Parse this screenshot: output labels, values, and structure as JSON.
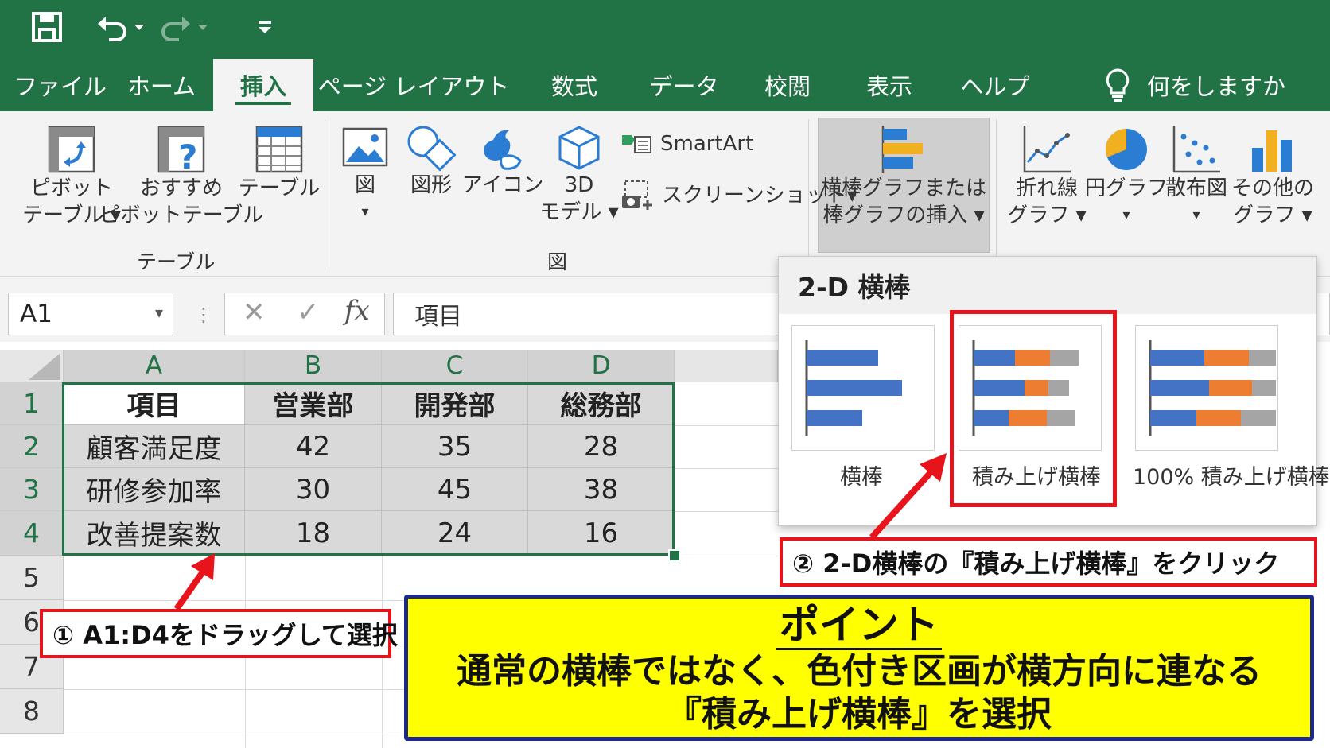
{
  "colors": {
    "excel_green": "#217346",
    "ribbon_bg": "#f3f3f3",
    "bar_blue": "#4472c4",
    "bar_orange": "#ed7d31",
    "bar_gray": "#a5a5a5",
    "annotation_red": "#e8141b",
    "point_yellow": "#ffff00",
    "point_border": "#1e2a8a"
  },
  "qat": {
    "save_icon": "save-icon",
    "undo_icon": "undo-icon",
    "redo_icon": "redo-icon",
    "customize_icon": "qat-dropdown-icon"
  },
  "tabs": [
    {
      "label": "ファイル"
    },
    {
      "label": "ホーム"
    },
    {
      "label": "挿入"
    },
    {
      "label": "ページ レイアウト"
    },
    {
      "label": "数式"
    },
    {
      "label": "データ"
    },
    {
      "label": "校閲"
    },
    {
      "label": "表示"
    },
    {
      "label": "ヘルプ"
    }
  ],
  "tell_me": {
    "icon": "lightbulb-icon",
    "label": "何をしますか"
  },
  "ribbon": {
    "pivot": {
      "line1": "ピボット",
      "line2": "テーブル"
    },
    "recommended_pivot": {
      "line1": "おすすめ",
      "line2": "ピボットテーブル"
    },
    "table": {
      "label": "テーブル"
    },
    "group_table": "テーブル",
    "picture": {
      "label": "図"
    },
    "shapes": {
      "label": "図形"
    },
    "icons": {
      "label": "アイコン"
    },
    "model3d": {
      "line1": "3D",
      "line2": "モデル"
    },
    "smartart": {
      "label": "SmartArt"
    },
    "screenshot": {
      "label": "スクリーンショット"
    },
    "group_illustrations": "図",
    "bar_chart": {
      "line1": "横棒グラフまたは",
      "line2": "棒グラフの挿入"
    },
    "line_chart": {
      "line1": "折れ線",
      "line2": "グラフ"
    },
    "pie_chart": {
      "label": "円グラフ"
    },
    "scatter_chart": {
      "label": "散布図"
    },
    "other_chart": {
      "line1": "その他の",
      "line2": "グラフ"
    }
  },
  "formula_bar": {
    "name_box": "A1",
    "cancel_icon": "cancel-icon",
    "enter_icon": "check-icon",
    "fx_icon": "fx-icon",
    "content": "項目"
  },
  "grid": {
    "columns": [
      "A",
      "B",
      "C",
      "D"
    ],
    "rows": [
      "1",
      "2",
      "3",
      "4",
      "5",
      "6",
      "7",
      "8"
    ],
    "cells": [
      [
        "項目",
        "営業部",
        "開発部",
        "総務部"
      ],
      [
        "顧客満足度",
        "42",
        "35",
        "28"
      ],
      [
        "研修参加率",
        "30",
        "45",
        "38"
      ],
      [
        "改善提案数",
        "18",
        "24",
        "16"
      ]
    ]
  },
  "gallery": {
    "title": "2-D 横棒",
    "items": [
      {
        "label": "横棒"
      },
      {
        "label": "積み上げ横棒"
      },
      {
        "label": "100% 積み上げ横棒"
      }
    ]
  },
  "callouts": {
    "step1": "① A1:D4をドラッグして選択",
    "step2": "② 2-D横棒の『積み上げ横棒』をクリック"
  },
  "point": {
    "title": "ポイント",
    "line1": "通常の横棒ではなく、色付き区画が横方向に連なる",
    "line2": "『積み上げ横棒』を選択"
  }
}
